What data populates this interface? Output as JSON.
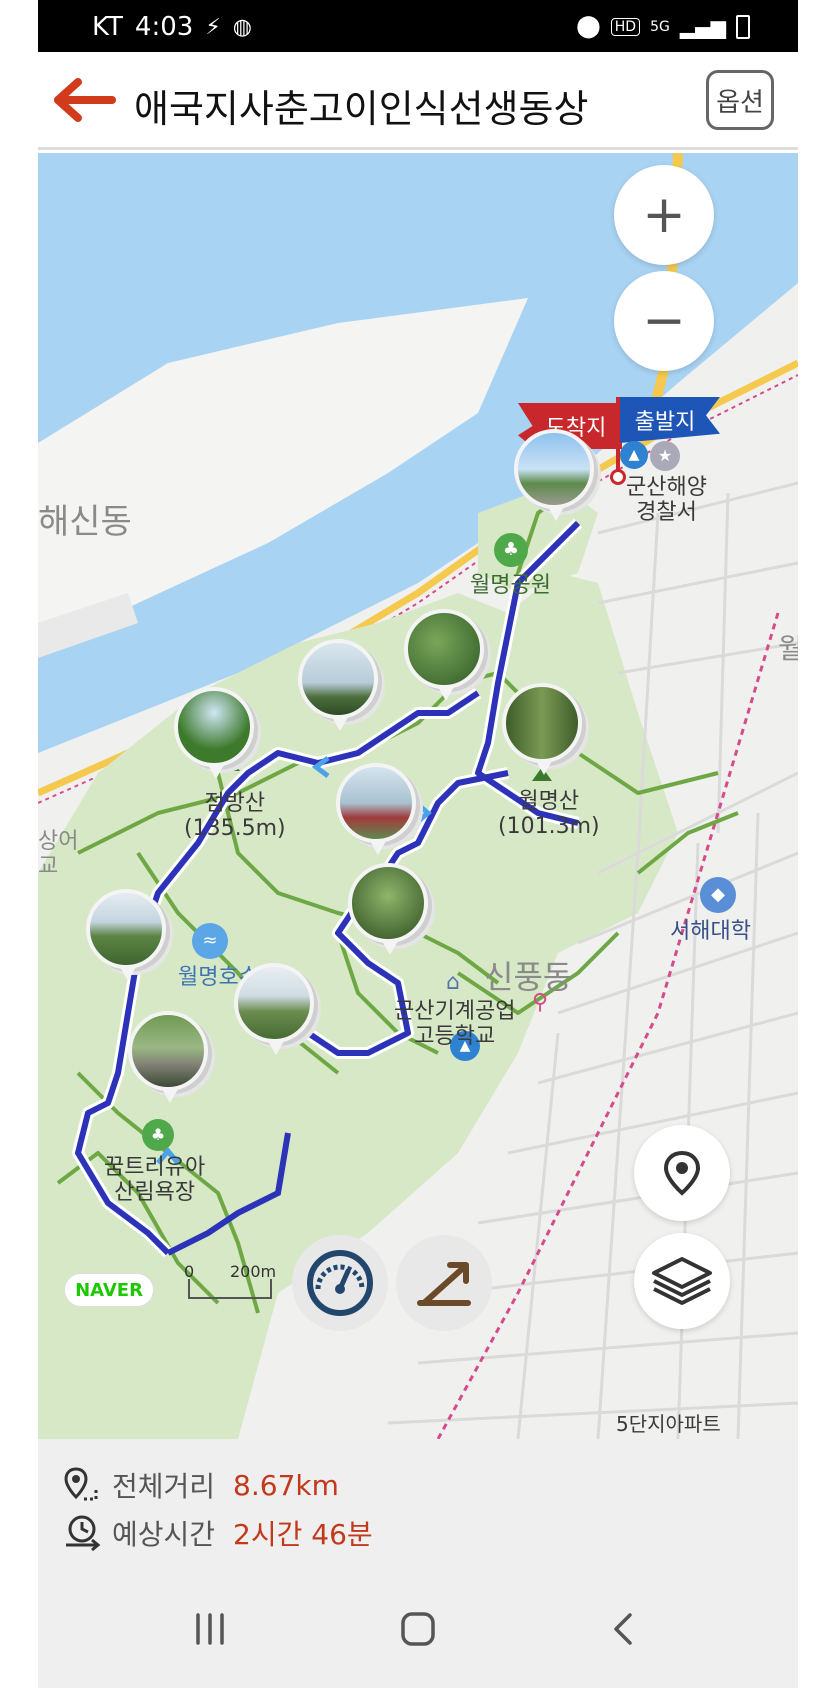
{
  "status_bar": {
    "carrier": "KT",
    "time": "4:03",
    "network": "5G",
    "hd": "HD"
  },
  "header": {
    "title": "애국지사춘고이인식선생동상",
    "option_label": "옵션"
  },
  "map": {
    "flags": {
      "end": "도착지",
      "start": "출발지"
    },
    "labels": {
      "haesin": "해신동",
      "wolmyeong_park": "월명공원",
      "jeombang_mt": "점방산\n(135.5m)",
      "wolmyeong_mt": "월명산\n(101.3m)",
      "coast_guard": "군산해양\n경찰서",
      "wolmyeong_lake": "월명호수",
      "sinpung": "신풍동",
      "mech_school": "군산기계공업\n고등학교",
      "forest_bath": "꿈트리유아\n산림욕장",
      "seohae_univ": "서해대학",
      "apt": "5단지아파트",
      "left_edge": "상어\n교",
      "right_edge": "월",
      "naver": "NAVER",
      "scale_zero": "0",
      "scale_dist": "200m"
    },
    "zoom_in": "+",
    "zoom_out": "−"
  },
  "info": {
    "distance_label": "전체거리",
    "distance_value": "8.67km",
    "time_label": "예상시간",
    "time_value": "2시간 46분"
  },
  "colors": {
    "accent": "#d13a1b",
    "route": "#2c33b8",
    "sea": "#a9d3f3",
    "forest": "#d7e8c7",
    "trail": "#6ea844"
  }
}
